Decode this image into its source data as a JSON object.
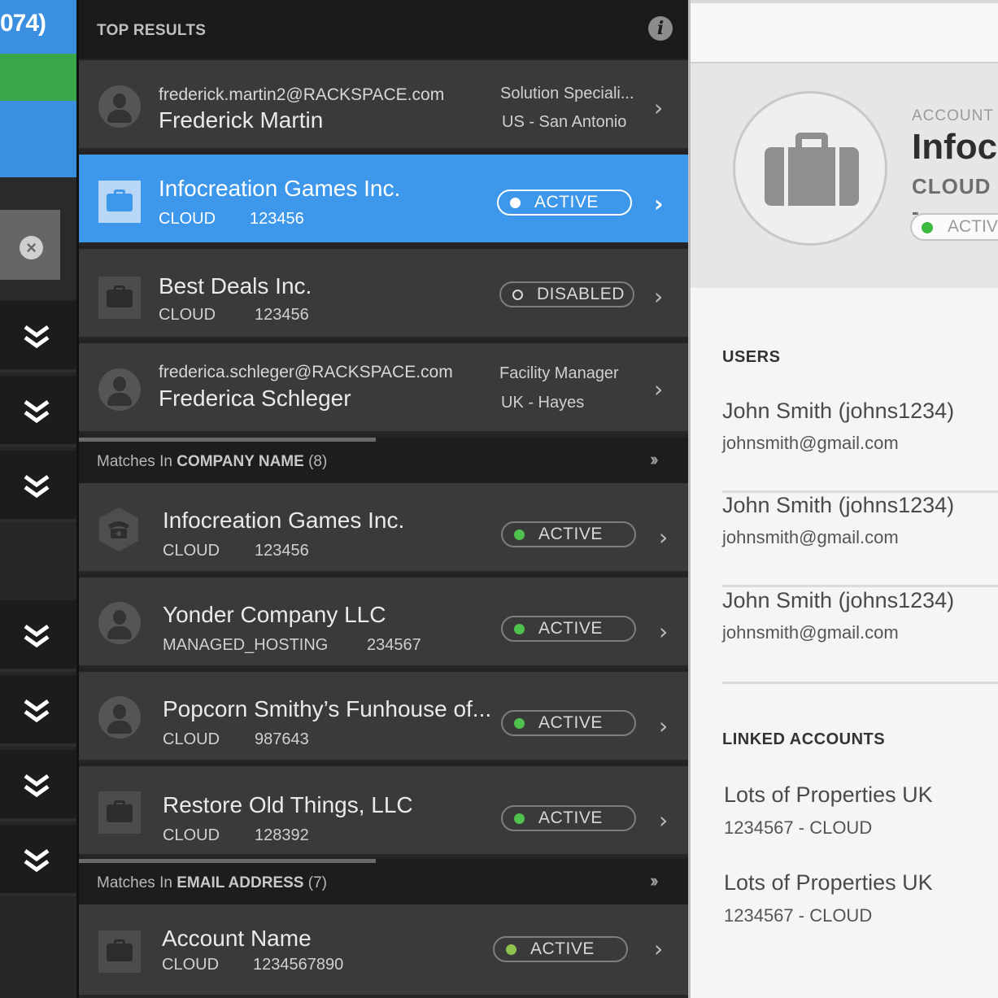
{
  "rail": {
    "count_text": "074)",
    "chevron_icon": "double-chevron-down-icon",
    "close_icon": "close-circle-icon"
  },
  "top_results": {
    "title": "TOP RESULTS",
    "info_icon": "info-icon"
  },
  "rows": [
    {
      "type": "user",
      "sub": "frederick.martin2@RACKSPACE.com",
      "title": "Frederick Martin",
      "meta1": "Solution Speciali...",
      "meta2": "US - San Antonio"
    },
    {
      "type": "account",
      "title": "Infocreation Games Inc.",
      "sub1": "CLOUD",
      "sub2": "123456",
      "status": "ACTIVE",
      "selected": true
    },
    {
      "type": "account",
      "title": "Best Deals Inc.",
      "sub1": "CLOUD",
      "sub2": "123456",
      "status": "DISABLED"
    },
    {
      "type": "user",
      "sub": "frederica.schleger@RACKSPACE.com",
      "title": "Frederica Schleger",
      "meta1": "Facility Manager",
      "meta2": "UK - Hayes"
    }
  ],
  "section_company": {
    "prefix": "Matches In ",
    "bold": "COMPANY NAME",
    "count": " (8)"
  },
  "company_rows": [
    {
      "icon": "phone-icon",
      "title": "Infocreation Games Inc.",
      "sub1": "CLOUD",
      "sub2": "123456",
      "status": "ACTIVE"
    },
    {
      "icon": "user-icon",
      "title": "Yonder Company LLC",
      "sub1": "MANAGED_HOSTING",
      "sub2": "234567",
      "status": "ACTIVE"
    },
    {
      "icon": "user-icon",
      "title": "Popcorn Smithy’s Funhouse of...",
      "sub1": "CLOUD",
      "sub2": "987643",
      "status": "ACTIVE"
    },
    {
      "icon": "briefcase-icon",
      "title": "Restore Old Things, LLC",
      "sub1": "CLOUD",
      "sub2": "128392",
      "status": "ACTIVE"
    }
  ],
  "section_email": {
    "prefix": "Matches In ",
    "bold": "EMAIL ADDRESS",
    "count": " (7)"
  },
  "email_rows": [
    {
      "icon": "briefcase-icon",
      "title": "Account Name",
      "sub1": "CLOUD",
      "sub2": "1234567890",
      "status": "ACTIVE"
    }
  ],
  "detail": {
    "account_label": "ACCOUNT",
    "account_name": "Infoc",
    "account_type": "CLOUD -",
    "status": "ACTIV",
    "users_heading": "USERS",
    "users": [
      {
        "name": "John Smith (johns1234)",
        "email": "johnsmith@gmail.com"
      },
      {
        "name": "John Smith (johns1234)",
        "email": "johnsmith@gmail.com"
      },
      {
        "name": "John Smith (johns1234)",
        "email": "johnsmith@gmail.com"
      }
    ],
    "linked_heading": "LINKED ACCOUNTS",
    "linked": [
      {
        "name": "Lots of Properties UK",
        "sub": "1234567 - CLOUD"
      },
      {
        "name": "Lots of Properties UK",
        "sub": "1234567 - CLOUD"
      }
    ]
  },
  "colors": {
    "accent": "#3d97ea",
    "active_green": "#4fc14f",
    "rail_green": "#3aa64a"
  }
}
